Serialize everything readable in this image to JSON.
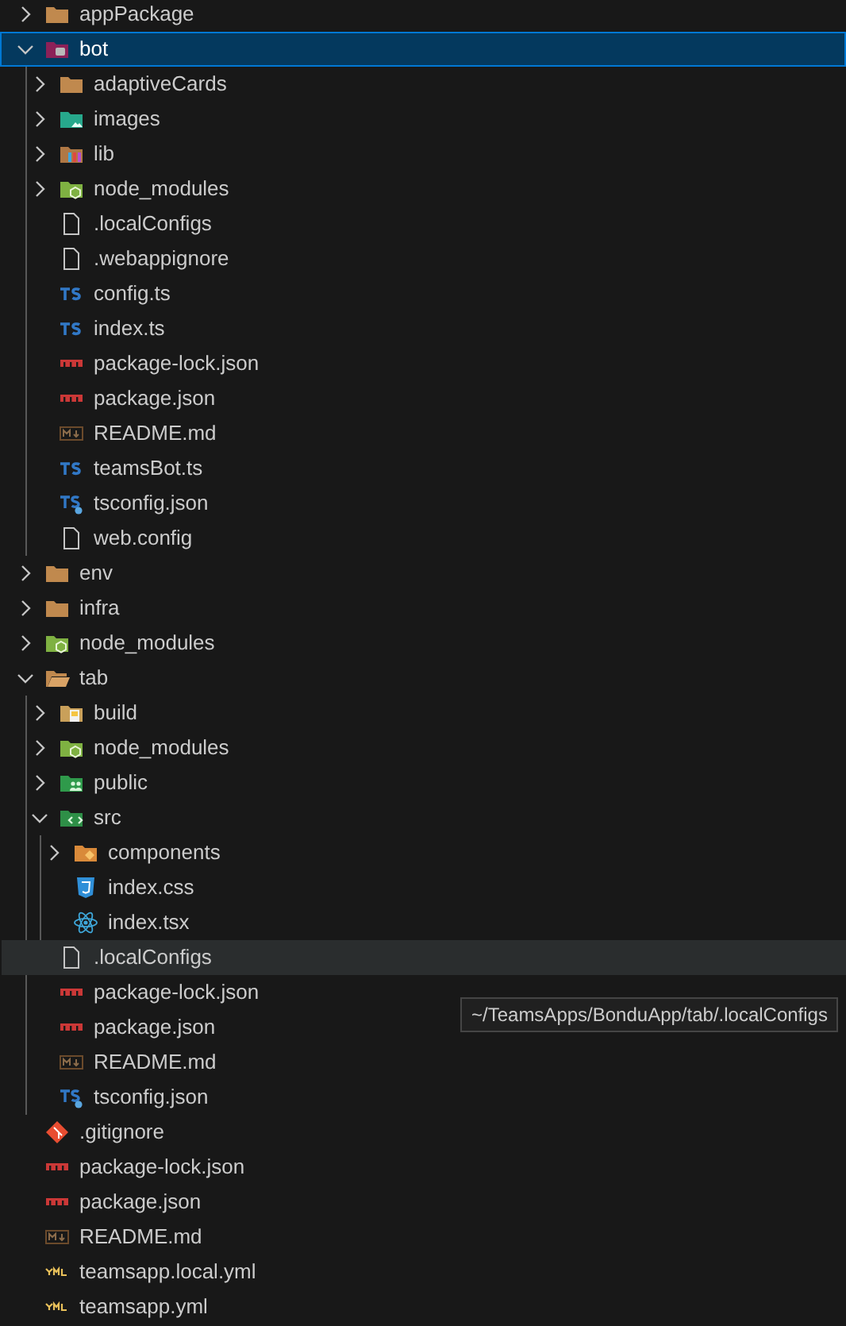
{
  "explorer": {
    "items": [
      {
        "label": "appPackage",
        "kind": "folder",
        "expanded": false,
        "selected": false,
        "hovered": false
      },
      {
        "label": "bot",
        "kind": "folder-bot",
        "expanded": true,
        "selected": true,
        "hovered": false,
        "children": [
          {
            "label": "adaptiveCards",
            "kind": "folder",
            "expanded": false,
            "selected": false,
            "hovered": false
          },
          {
            "label": "images",
            "kind": "folder-images",
            "expanded": false,
            "selected": false,
            "hovered": false
          },
          {
            "label": "lib",
            "kind": "folder-lib",
            "expanded": false,
            "selected": false,
            "hovered": false
          },
          {
            "label": "node_modules",
            "kind": "folder-node",
            "expanded": false,
            "selected": false,
            "hovered": false
          },
          {
            "label": ".localConfigs",
            "kind": "file",
            "selected": false,
            "hovered": false
          },
          {
            "label": ".webappignore",
            "kind": "file",
            "selected": false,
            "hovered": false
          },
          {
            "label": "config.ts",
            "kind": "ts",
            "selected": false,
            "hovered": false
          },
          {
            "label": "index.ts",
            "kind": "ts",
            "selected": false,
            "hovered": false
          },
          {
            "label": "package-lock.json",
            "kind": "npm",
            "selected": false,
            "hovered": false
          },
          {
            "label": "package.json",
            "kind": "npm",
            "selected": false,
            "hovered": false
          },
          {
            "label": "README.md",
            "kind": "md",
            "selected": false,
            "hovered": false
          },
          {
            "label": "teamsBot.ts",
            "kind": "ts",
            "selected": false,
            "hovered": false
          },
          {
            "label": "tsconfig.json",
            "kind": "tsconfig",
            "selected": false,
            "hovered": false
          },
          {
            "label": "web.config",
            "kind": "file",
            "selected": false,
            "hovered": false
          }
        ]
      },
      {
        "label": "env",
        "kind": "folder",
        "expanded": false,
        "selected": false,
        "hovered": false
      },
      {
        "label": "infra",
        "kind": "folder",
        "expanded": false,
        "selected": false,
        "hovered": false
      },
      {
        "label": "node_modules",
        "kind": "folder-node",
        "expanded": false,
        "selected": false,
        "hovered": false
      },
      {
        "label": "tab",
        "kind": "folder",
        "expanded": true,
        "selected": false,
        "hovered": false,
        "children": [
          {
            "label": "build",
            "kind": "folder-build",
            "expanded": false,
            "selected": false,
            "hovered": false
          },
          {
            "label": "node_modules",
            "kind": "folder-node",
            "expanded": false,
            "selected": false,
            "hovered": false
          },
          {
            "label": "public",
            "kind": "folder-public",
            "expanded": false,
            "selected": false,
            "hovered": false
          },
          {
            "label": "src",
            "kind": "folder-src",
            "expanded": true,
            "selected": false,
            "hovered": false,
            "children": [
              {
                "label": "components",
                "kind": "folder-components",
                "expanded": false,
                "selected": false,
                "hovered": false
              },
              {
                "label": "index.css",
                "kind": "css",
                "selected": false,
                "hovered": false
              },
              {
                "label": "index.tsx",
                "kind": "react",
                "selected": false,
                "hovered": false
              }
            ]
          },
          {
            "label": ".localConfigs",
            "kind": "file",
            "selected": false,
            "hovered": true
          },
          {
            "label": "package-lock.json",
            "kind": "npm",
            "selected": false,
            "hovered": false
          },
          {
            "label": "package.json",
            "kind": "npm",
            "selected": false,
            "hovered": false
          },
          {
            "label": "README.md",
            "kind": "md",
            "selected": false,
            "hovered": false
          },
          {
            "label": "tsconfig.json",
            "kind": "tsconfig",
            "selected": false,
            "hovered": false
          }
        ]
      },
      {
        "label": ".gitignore",
        "kind": "git",
        "selected": false,
        "hovered": false
      },
      {
        "label": "package-lock.json",
        "kind": "npm",
        "selected": false,
        "hovered": false
      },
      {
        "label": "package.json",
        "kind": "npm",
        "selected": false,
        "hovered": false
      },
      {
        "label": "README.md",
        "kind": "md",
        "selected": false,
        "hovered": false
      },
      {
        "label": "teamsapp.local.yml",
        "kind": "yaml",
        "selected": false,
        "hovered": false
      },
      {
        "label": "teamsapp.yml",
        "kind": "yaml",
        "selected": false,
        "hovered": false
      }
    ]
  },
  "tooltip": {
    "text": "~/TeamsApps/BonduApp/tab/.localConfigs"
  }
}
